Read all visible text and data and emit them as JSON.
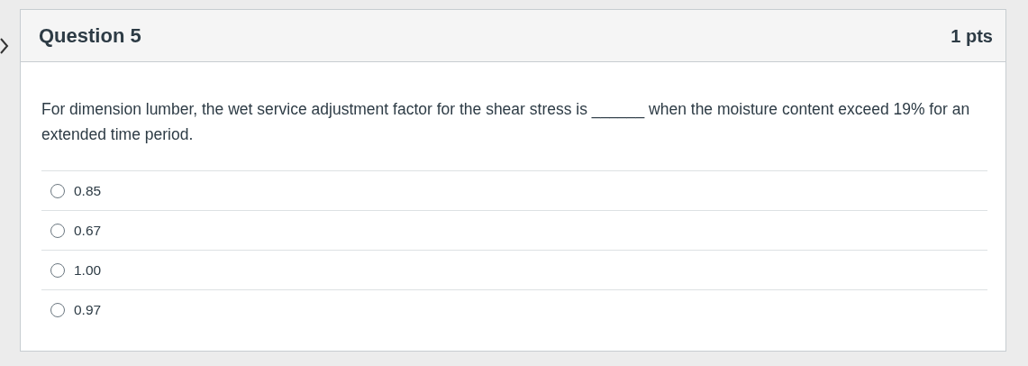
{
  "question": {
    "title": "Question 5",
    "points": "1 pts",
    "text": "For dimension lumber, the wet service adjustment factor for the shear stress is ______ when the moisture content exceed 19% for an extended time period.",
    "answers": [
      {
        "label": "0.85",
        "selected": false
      },
      {
        "label": "0.67",
        "selected": false
      },
      {
        "label": "1.00",
        "selected": false
      },
      {
        "label": "0.97",
        "selected": false
      }
    ]
  }
}
